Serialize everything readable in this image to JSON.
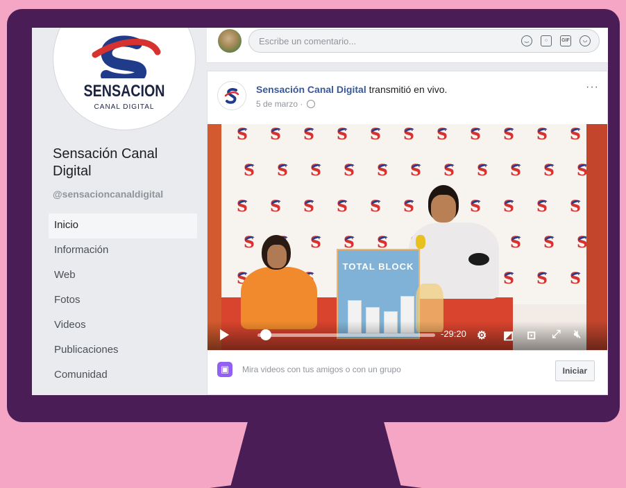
{
  "page": {
    "name": "Sensación Canal Digital",
    "handle": "@sensacioncanaldigital",
    "logo_word": "SENSACION",
    "logo_sub": "CANAL DIGITAL"
  },
  "nav": {
    "items": [
      "Inicio",
      "Información",
      "Web",
      "Fotos",
      "Videos",
      "Publicaciones",
      "Comunidad"
    ],
    "active": "Inicio"
  },
  "comment": {
    "placeholder": "Escribe un comentario...",
    "icons": [
      "emoji-icon",
      "camera-icon",
      "gif-icon",
      "sticker-icon"
    ]
  },
  "post": {
    "author": "Sensación Canal Digital",
    "action": " transmitió en vivo.",
    "date": "5 de marzo ·",
    "more": "···"
  },
  "video": {
    "product_title": "TOTAL BLOCK",
    "time_remaining": "-29:20",
    "progress": 0.03
  },
  "watch": {
    "text": "Mira videos con tus amigos o con un grupo",
    "button": "Iniciar"
  },
  "colors": {
    "frame": "#4a1d56",
    "background": "#f4a6c4",
    "link": "#385898",
    "watch_party": "#9360f7"
  }
}
